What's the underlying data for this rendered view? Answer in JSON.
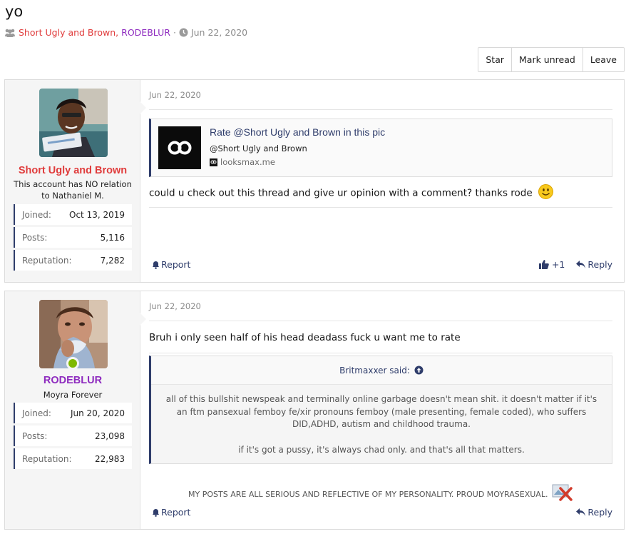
{
  "thread": {
    "title": "yo",
    "author_a": "Short Ugly and Brown",
    "author_sep": ",",
    "author_b": "RODEBLUR",
    "dot": "·",
    "date": "Jun 22, 2020"
  },
  "actions": {
    "star": "Star",
    "mark_unread": "Mark unread",
    "leave": "Leave"
  },
  "posts": [
    {
      "user": {
        "name": "Short Ugly and Brown",
        "name_color": "#e03c3c",
        "title": "This account has NO relation to Nathaniel M.",
        "stats": [
          {
            "label": "Joined:",
            "value": "Oct 13, 2019"
          },
          {
            "label": "Posts:",
            "value": "5,116"
          },
          {
            "label": "Reputation:",
            "value": "7,282"
          }
        ]
      },
      "date": "Jun 22, 2020",
      "embed": {
        "title": "Rate @Short Ugly and Brown in this pic",
        "desc": "@Short Ugly and Brown",
        "site": "looksmax.me"
      },
      "message": "could u check out this thread and give ur opinion with a comment? thanks rode",
      "report": "Report",
      "likes": "+1",
      "reply": "Reply"
    },
    {
      "user": {
        "name": "RODEBLUR",
        "name_color": "#8e2bbf",
        "title": "Moyra Forever",
        "stats": [
          {
            "label": "Joined:",
            "value": "Jun 20, 2020"
          },
          {
            "label": "Posts:",
            "value": "23,098"
          },
          {
            "label": "Reputation:",
            "value": "22,983"
          }
        ]
      },
      "date": "Jun 22, 2020",
      "message": "Bruh i only seen half of his head deadass fuck u want me to rate",
      "quote": {
        "author": "Britmaxxer said:",
        "paragraph1": "all of this bullshit newspeak and terminally online garbage doesn't mean shit. it doesn't matter if it's an ftm pansexual femboy fe/xir pronouns femboy (male presenting, female coded), who suffers DID,ADHD, autism and childhood trauma.",
        "paragraph2": "if it's got a pussy, it's always chad only. and that's all that matters."
      },
      "signature": "MY POSTS ARE ALL SERIOUS AND REFLECTIVE OF MY PERSONALITY. PROUD MOYRASEXUAL.",
      "report": "Report",
      "reply": "Reply"
    }
  ]
}
